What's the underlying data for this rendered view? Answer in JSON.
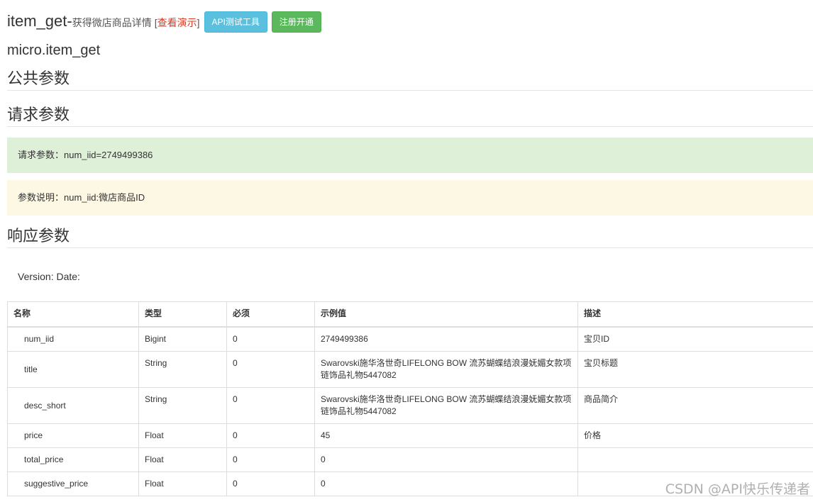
{
  "header": {
    "api_name": "item_get-",
    "api_desc": "获得微店商品详情",
    "demo_open": "[",
    "demo_link": "查看演示",
    "demo_close": "]",
    "btn_api_tool": "API测试工具",
    "btn_register": "注册开通"
  },
  "method_name": "micro.item_get",
  "sections": {
    "public_params": "公共参数",
    "request_params": "请求参数",
    "response_params": "响应参数"
  },
  "alerts": {
    "request_example": "请求参数：num_iid=2749499386",
    "param_desc": "参数说明：num_iid:微店商品ID"
  },
  "version_line": "Version: Date:",
  "table": {
    "headers": [
      "名称",
      "类型",
      "必须",
      "示例值",
      "描述"
    ],
    "rows": [
      {
        "name": "num_iid",
        "type": "Bigint",
        "required": "0",
        "example": "2749499386",
        "desc": "宝贝ID"
      },
      {
        "name": "title",
        "type": "String",
        "required": "0",
        "example": "Swarovski施华洛世奇LIFELONG BOW 流苏蝴蝶结浪漫妩媚女款项链饰品礼物5447082",
        "desc": "宝贝标题"
      },
      {
        "name": "desc_short",
        "type": "String",
        "required": "0",
        "example": "Swarovski施华洛世奇LIFELONG BOW 流苏蝴蝶结浪漫妩媚女款项链饰品礼物5447082",
        "desc": "商品简介"
      },
      {
        "name": "price",
        "type": "Float",
        "required": "0",
        "example": "45",
        "desc": "价格"
      },
      {
        "name": "total_price",
        "type": "Float",
        "required": "0",
        "example": "0",
        "desc": ""
      },
      {
        "name": "suggestive_price",
        "type": "Float",
        "required": "0",
        "example": "0",
        "desc": ""
      }
    ]
  },
  "watermark": "CSDN @API快乐传递者"
}
